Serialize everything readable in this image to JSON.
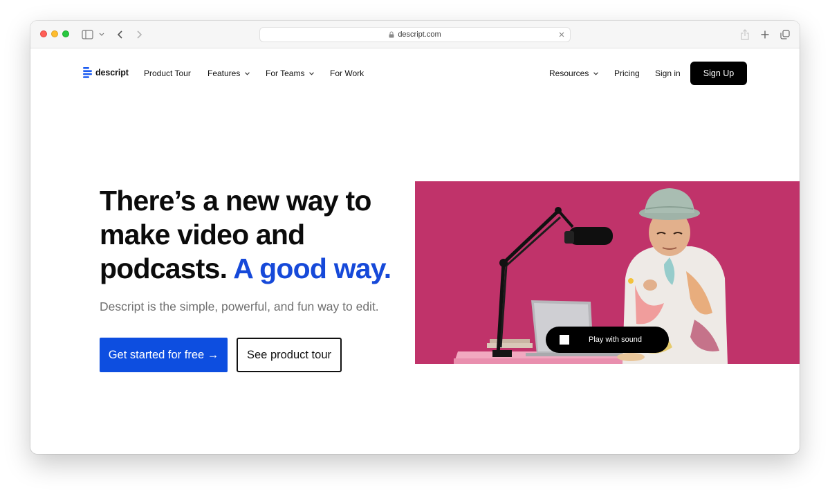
{
  "browser": {
    "url": "descript.com"
  },
  "nav": {
    "logo_text": "descript",
    "product_tour": "Product Tour",
    "features": "Features",
    "for_teams": "For Teams",
    "for_work": "For Work",
    "resources": "Resources",
    "pricing": "Pricing",
    "sign_in": "Sign in",
    "sign_up": "Sign Up"
  },
  "hero": {
    "headline_line1": "There’s a new way to",
    "headline_line2": "make video and",
    "headline_line3": "podcasts.",
    "headline_accent": "A good way.",
    "subheadline": "Descript is the simple, powerful, and fun way to edit.",
    "cta_primary": "Get started for free →",
    "cta_secondary": "See product tour"
  },
  "video": {
    "play_label": "Play with sound"
  },
  "colors": {
    "accent_blue": "#1649d9",
    "cta_blue": "#0d4ee0",
    "video_background": "#c0336a"
  }
}
